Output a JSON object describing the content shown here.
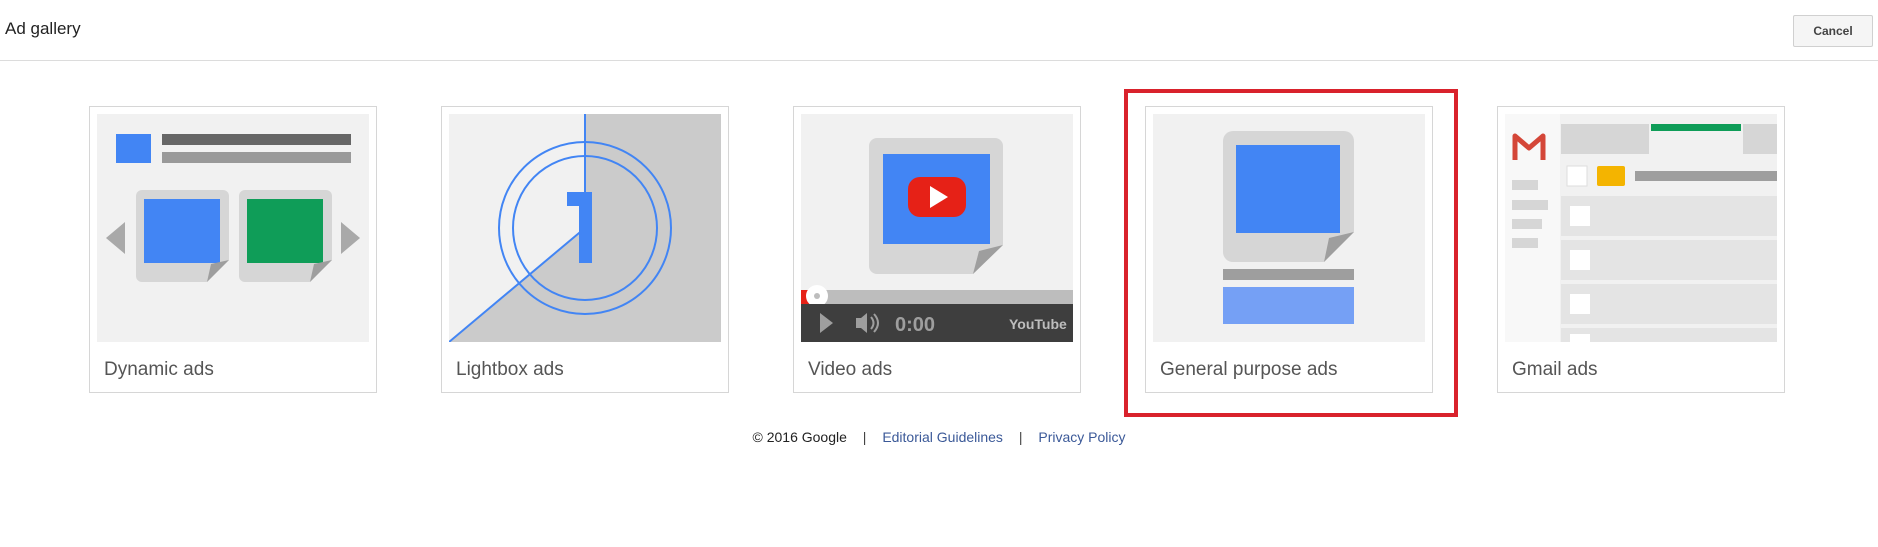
{
  "header": {
    "title": "Ad gallery",
    "cancel_label": "Cancel"
  },
  "cards": [
    {
      "label": "Dynamic ads"
    },
    {
      "label": "Lightbox ads"
    },
    {
      "label": "Video ads",
      "player_time": "0:00",
      "player_brand": "YouTube"
    },
    {
      "label": "General purpose ads",
      "selected": true
    },
    {
      "label": "Gmail ads"
    }
  ],
  "footer": {
    "copyright": "© 2016 Google",
    "separator": "|",
    "editorial_link": "Editorial Guidelines",
    "privacy_link": "Privacy Policy"
  },
  "colors": {
    "blue": "#4285f4",
    "green": "#0f9d58",
    "youtube_red": "#e62117",
    "selection_red": "#d9222c",
    "link": "#3b5998"
  }
}
